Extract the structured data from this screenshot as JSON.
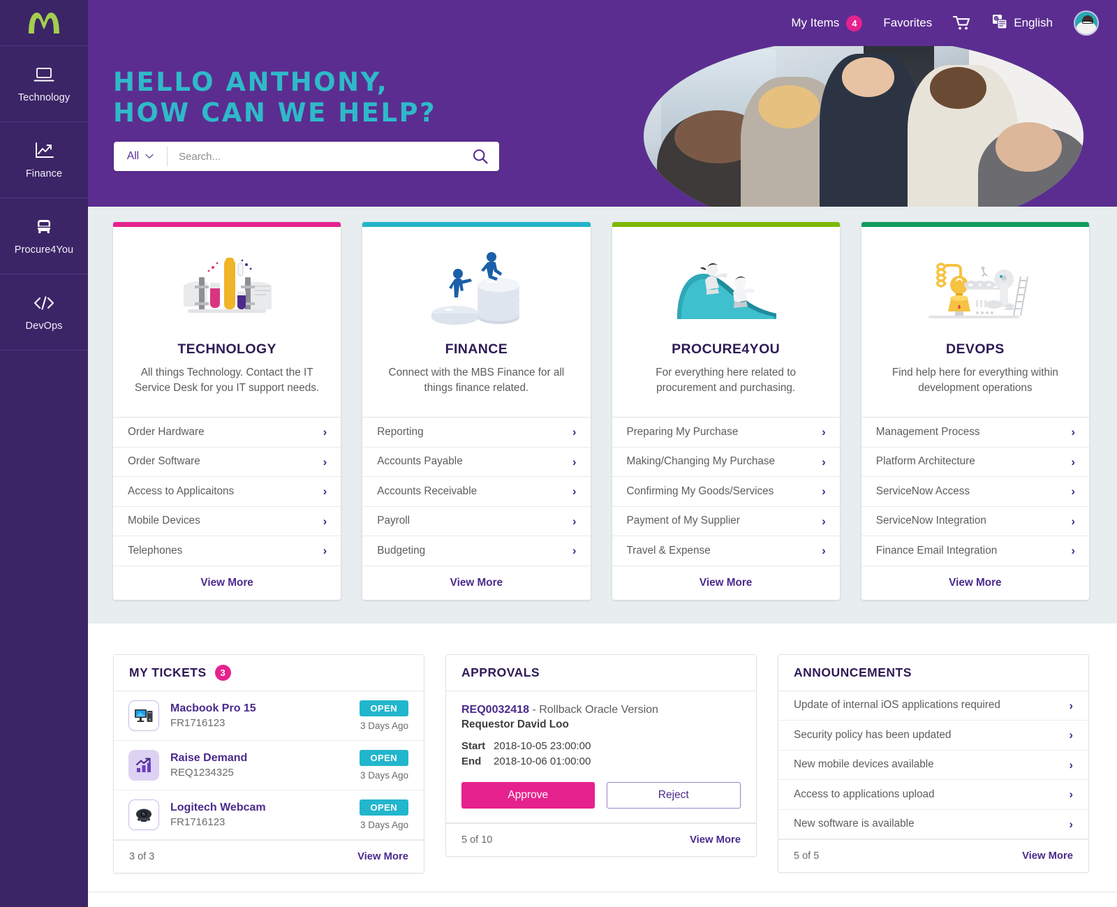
{
  "brand": {
    "logo_name": "merck-m-logo",
    "sidebar_bg": "#3B2566",
    "topbar_bg": "#5B2D90",
    "accent_pink": "#E5228D",
    "accent_cyan": "#22B6CC",
    "accent_purple": "#4B2A8C"
  },
  "sidebar": {
    "items": [
      {
        "label": "Technology",
        "icon": "laptop-icon"
      },
      {
        "label": "Finance",
        "icon": "chart-line-icon"
      },
      {
        "label": "Procure4You",
        "icon": "bus-icon"
      },
      {
        "label": "DevOps",
        "icon": "code-brackets-icon"
      }
    ]
  },
  "topbar": {
    "my_items_label": "My Items",
    "my_items_count": "4",
    "favorites_label": "Favorites",
    "cart_icon": "shopping-cart-icon",
    "language_icon": "language-icon",
    "language_label": "English",
    "avatar_name": "user-avatar"
  },
  "hero": {
    "greeting_line1": "HELLO ANTHONY,",
    "greeting_line2": "HOW CAN WE HELP?",
    "search": {
      "scope_label": "All",
      "scope_caret": "chevron-down-icon",
      "placeholder": "Search...",
      "value": "",
      "submit_icon": "search-icon"
    },
    "image_alt": "business-team-photo"
  },
  "cards": [
    {
      "accent": "#E5228D",
      "illustration": "lab-tubes-illustration",
      "title": "TECHNOLOGY",
      "description": "All things Technology. Contact the IT Service Desk for you IT support needs.",
      "links": [
        "Order Hardware",
        "Order Software",
        "Access to Applicaitons",
        "Mobile Devices",
        "Telephones"
      ],
      "view_more": "View More"
    },
    {
      "accent": "#22B4C8",
      "illustration": "coins-climb-illustration",
      "title": "FINANCE",
      "description": "Connect with the MBS Finance for all things finance related.",
      "links": [
        "Reporting",
        "Accounts Payable",
        "Accounts Receivable",
        "Payroll",
        "Budgeting"
      ],
      "view_more": "View More"
    },
    {
      "accent": "#7DB800",
      "illustration": "playground-slide-illustration",
      "title": "PROCURE4YOU",
      "description": "For everything here related to procurement and purchasing.",
      "links": [
        "Preparing My Purchase",
        "Making/Changing My Purchase",
        "Confirming My Goods/Services",
        "Payment of My Supplier",
        "Travel & Expense"
      ],
      "view_more": "View More"
    },
    {
      "accent": "#109B5E",
      "illustration": "lab-bulb-illustration",
      "title": "DEVOPS",
      "description": "Find help here for everything within development operations",
      "links": [
        "Management Process",
        "Platform Architecture",
        "ServiceNow Access",
        "ServiceNow Integration",
        "Finance Email Integration"
      ],
      "view_more": "View More"
    }
  ],
  "tickets_panel": {
    "title": "MY TICKETS",
    "count": "3",
    "items": [
      {
        "name": "Macbook Pro 15",
        "number": "FR1716123",
        "status": "OPEN",
        "age": "3 Days Ago",
        "icon": "desktop-computer-icon"
      },
      {
        "name": "Raise Demand",
        "number": "REQ1234325",
        "status": "OPEN",
        "age": "3 Days Ago",
        "icon": "bar-chart-icon"
      },
      {
        "name": "Logitech Webcam",
        "number": "FR1716123",
        "status": "OPEN",
        "age": "3 Days Ago",
        "icon": "webcam-icon"
      }
    ],
    "footer_count": "3 of 3",
    "view_more": "View More"
  },
  "approvals_panel": {
    "title": "APPROVALS",
    "request_id": "REQ0032418",
    "request_separator": " - ",
    "request_title": "Rollback Oracle Version",
    "requestor_line": "Requestor David Loo",
    "start_label": "Start",
    "start_value": "2018-10-05 23:00:00",
    "end_label": "End",
    "end_value": "2018-10-06 01:00:00",
    "approve_label": "Approve",
    "reject_label": "Reject",
    "footer_count": "5 of 10",
    "view_more": "View More"
  },
  "announcements_panel": {
    "title": "ANNOUNCEMENTS",
    "items": [
      "Update of internal iOS applications required",
      "Security policy has been updated",
      "New mobile devices available",
      "Access to applications upload",
      "New software is available"
    ],
    "footer_count": "5 of 5",
    "view_more": "View More"
  }
}
